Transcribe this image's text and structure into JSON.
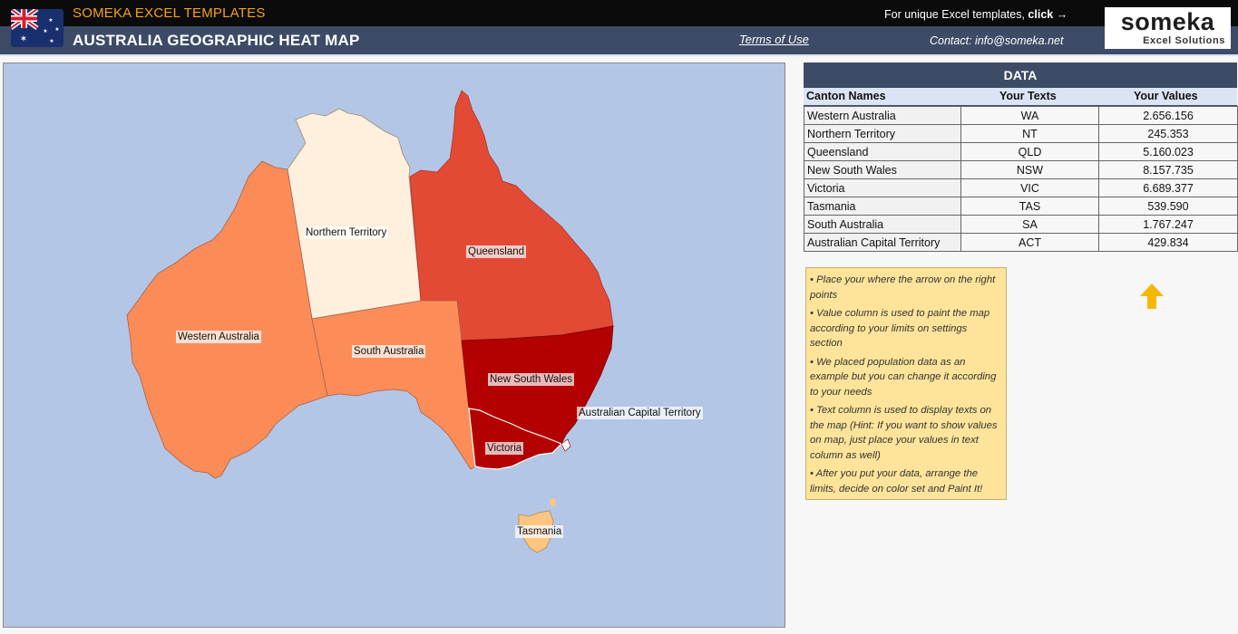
{
  "header": {
    "brand": "SOMEKA EXCEL TEMPLATES",
    "title": "AUSTRALIA GEOGRAPHIC HEAT MAP",
    "terms": "Terms of Use",
    "unique_prefix": "For unique Excel templates, ",
    "unique_click": "click →",
    "contact": "Contact: info@someka.net",
    "logo_main": "someka",
    "logo_sub": "Excel Solutions",
    "flag_icon": "australia-flag-icon"
  },
  "map": {
    "labels": {
      "wa": "Western Australia",
      "nt": "Northern Territory",
      "qld": "Queensland",
      "sa": "South Australia",
      "nsw": "New South Wales",
      "act": "Australian Capital Territory",
      "vic": "Victoria",
      "tas": "Tasmania"
    },
    "colors": {
      "ocean": "#b4c6e6",
      "wa": "#fb8c58",
      "nt": "#fef0dc",
      "qld": "#e34a33",
      "sa": "#fc8d59",
      "nsw": "#b30000",
      "vic": "#b30000",
      "tas": "#fdc580",
      "act": "#ffffff"
    }
  },
  "data_table": {
    "title": "DATA",
    "headers": [
      "Canton Names",
      "Your Texts",
      "Your Values"
    ],
    "rows": [
      {
        "name": "Western Australia",
        "text": "WA",
        "value": "2.656.156"
      },
      {
        "name": "Northern Territory",
        "text": "NT",
        "value": "245.353"
      },
      {
        "name": "Queensland",
        "text": "QLD",
        "value": "5.160.023"
      },
      {
        "name": "New South Wales",
        "text": "NSW",
        "value": "8.157.735"
      },
      {
        "name": "Victoria",
        "text": "VIC",
        "value": "6.689.377"
      },
      {
        "name": "Tasmania",
        "text": "TAS",
        "value": "539.590"
      },
      {
        "name": "South Australia",
        "text": "SA",
        "value": "1.767.247"
      },
      {
        "name": "Australian Capital Territory",
        "text": "ACT",
        "value": "429.834"
      }
    ]
  },
  "notes": [
    "• Place your where the arrow on the right points",
    "• Value column is used to paint the map according to your limits on settings section",
    "• We placed population data as an example but you can change it according to your needs",
    "• Text column is used to display texts on the map (Hint: If you want to show values on map, just place your values in text column as well)",
    "• After you put your data, arrange the limits, decide on color set and Paint It!"
  ],
  "arrow_icon": "arrow-up-icon",
  "arrow_color": "#f5b800"
}
